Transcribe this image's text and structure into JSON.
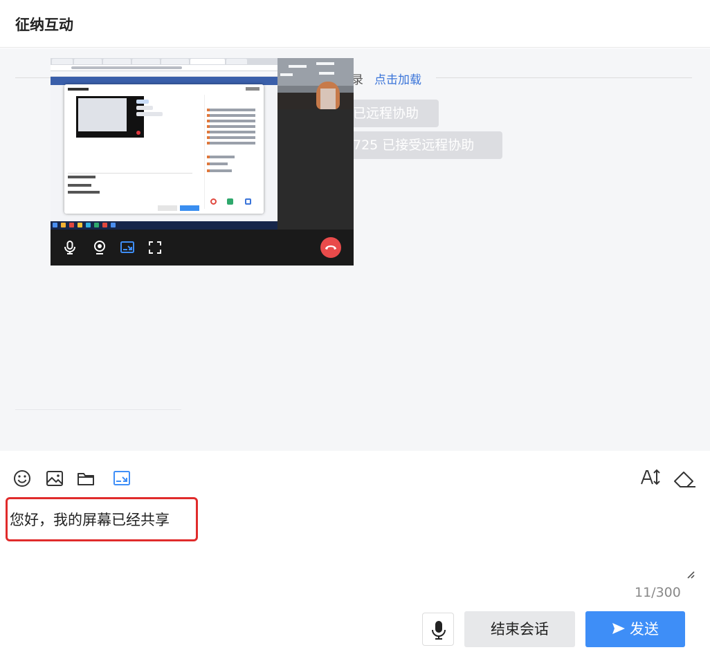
{
  "panel": {
    "title": "征纳互动"
  },
  "history": {
    "text": "录",
    "link": "点击加载"
  },
  "system_messages": [
    {
      "text": "已远程协助"
    },
    {
      "text": "725 已接受远程协助"
    }
  ],
  "video_call": {
    "controls": [
      "microphone-icon",
      "camera-icon",
      "screen-share-icon",
      "fullscreen-icon",
      "hangup-icon"
    ],
    "hangup_color": "#e94b4b"
  },
  "toolbar": {
    "icons": [
      "emoji-icon",
      "image-icon",
      "folder-icon",
      "screen-share-icon",
      "font-size-icon",
      "eraser-icon"
    ],
    "active_color": "#3e8ef7"
  },
  "message_input": {
    "value": "您好，我的屏幕已经共享",
    "counter": "11/300",
    "highlight_color": "#e02b2b"
  },
  "actions": {
    "voice_icon": "microphone-icon",
    "end_label": "结束会话",
    "send_label": "发送",
    "send_color": "#3e8ef7"
  }
}
